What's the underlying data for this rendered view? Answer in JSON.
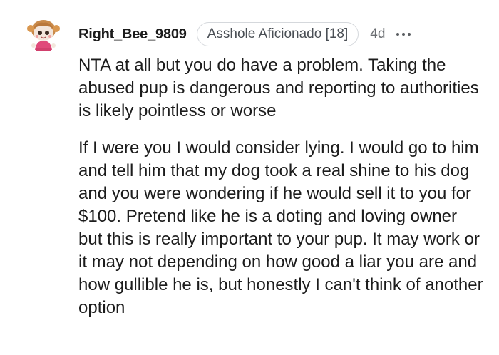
{
  "comment": {
    "username": "Right_Bee_9809",
    "flair": "Asshole Aficionado [18]",
    "time": "4d",
    "avatar_icon": "snoo-avatar-icon",
    "more_icon": "more-options-icon",
    "paragraphs": [
      "NTA at all but you do have a problem. Taking the abused pup is dangerous and reporting to authorities is likely pointless or worse",
      "If I were you I would consider lying. I would go to him and tell him that my dog took a real shine to his dog and you were wondering if he would sell it to you for $100. Pretend like he is a doting and loving owner but this is really important to your pup. It may work or it may not depending on how good a liar you are and how gullible he is, but honestly I can't think of another option"
    ]
  }
}
